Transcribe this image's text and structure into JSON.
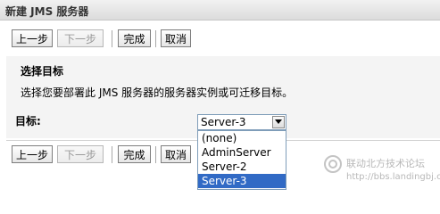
{
  "window": {
    "title": "新建 JMS 服务器"
  },
  "toolbar": {
    "back": "上一步",
    "next": "下一步",
    "finish": "完成",
    "cancel": "取消"
  },
  "section": {
    "title": "选择目标",
    "description": "选择您要部署此 JMS 服务器的服务器实例或可迁移目标。"
  },
  "target": {
    "label": "目标:",
    "selected": "Server-3",
    "options": [
      "(none)",
      "AdminServer",
      "Server-2",
      "Server-3"
    ]
  },
  "watermark": {
    "text": "联动北方技术论坛",
    "url": "http://bbs.landingbj.com"
  }
}
